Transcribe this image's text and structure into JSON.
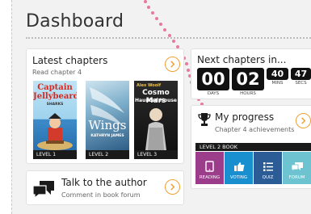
{
  "page": {
    "title": "Dashboard"
  },
  "latest": {
    "title": "Latest chapters",
    "subtitle": "Read chapter 4",
    "books": [
      {
        "level": "LEVEL 1",
        "cover_lines": [
          "Captain",
          "Jellybeard"
        ],
        "cover_small": "SHARKS"
      },
      {
        "level": "LEVEL 2",
        "cover_lines": [
          "Wings"
        ],
        "cover_small": "KATHRYN JAMES"
      },
      {
        "level": "LEVEL 3",
        "cover_lines": [
          "Cosmo Mars",
          "Haunted House"
        ],
        "cover_small": "Alex Woolf"
      }
    ]
  },
  "next": {
    "title": "Next chapters in...",
    "days": "00",
    "hours": "02",
    "mins": "40",
    "secs": "47",
    "days_label": "DAYS",
    "hours_label": "HOURS",
    "mins_label": "MINS",
    "secs_label": "SECS"
  },
  "progress": {
    "title": "My progress",
    "subtitle": "Chapter 4 achievements",
    "level_label": "LEVEL 2 BOOK",
    "tiles": [
      {
        "label": "READING",
        "color": "#9b3d8a"
      },
      {
        "label": "VOTING",
        "color": "#1a8fd0"
      },
      {
        "label": "QUIZ",
        "color": "#2b5c96"
      },
      {
        "label": "FORUM",
        "color": "#6ec3d0"
      }
    ]
  },
  "author": {
    "title": "Talk to the author",
    "subtitle": "Comment in book forum"
  },
  "colors": {
    "accent": "#f0a030",
    "trail": "#e8799a"
  }
}
